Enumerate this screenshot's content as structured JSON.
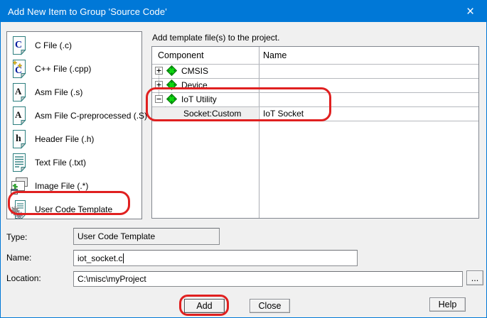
{
  "window": {
    "title": "Add New Item to Group 'Source Code'",
    "close_glyph": "×"
  },
  "left_list": {
    "items": [
      {
        "label": "C File (.c)",
        "icon": "c-file"
      },
      {
        "label": "C++ File (.cpp)",
        "icon": "cpp-file"
      },
      {
        "label": "Asm File (.s)",
        "icon": "asm-file"
      },
      {
        "label": "Asm File C-preprocessed (.S)",
        "icon": "asm-file-preprocessed"
      },
      {
        "label": "Header File (.h)",
        "icon": "header-file"
      },
      {
        "label": "Text File (.txt)",
        "icon": "text-file"
      },
      {
        "label": "Image File (.*)",
        "icon": "image-file"
      },
      {
        "label": "User Code Template",
        "icon": "user-code-template"
      }
    ],
    "selected": "User Code Template"
  },
  "panel": {
    "caption": "Add template file(s) to the project.",
    "table": {
      "headers": {
        "component": "Component",
        "name": "Name"
      },
      "rows": [
        {
          "component": "CMSIS",
          "name": "",
          "state": "collapsed",
          "level": 0
        },
        {
          "component": "Device",
          "name": "",
          "state": "collapsed",
          "level": 0
        },
        {
          "component": "IoT Utility",
          "name": "",
          "state": "expanded",
          "level": 0
        },
        {
          "component": "Socket:Custom",
          "name": "IoT Socket",
          "state": "leaf",
          "level": 1
        }
      ]
    }
  },
  "fields": {
    "type": {
      "label": "Type:",
      "value": "User Code Template"
    },
    "name": {
      "label": "Name:",
      "value": "iot_socket.c"
    },
    "location": {
      "label": "Location:",
      "value": "C:\\misc\\myProject",
      "browse": "..."
    }
  },
  "buttons": {
    "add": "Add",
    "close": "Close",
    "help": "Help"
  },
  "annotations": {
    "color": "#E02020",
    "highlighted": [
      "user-code-template-item",
      "iot-utility-tree-rows",
      "add-button"
    ]
  }
}
